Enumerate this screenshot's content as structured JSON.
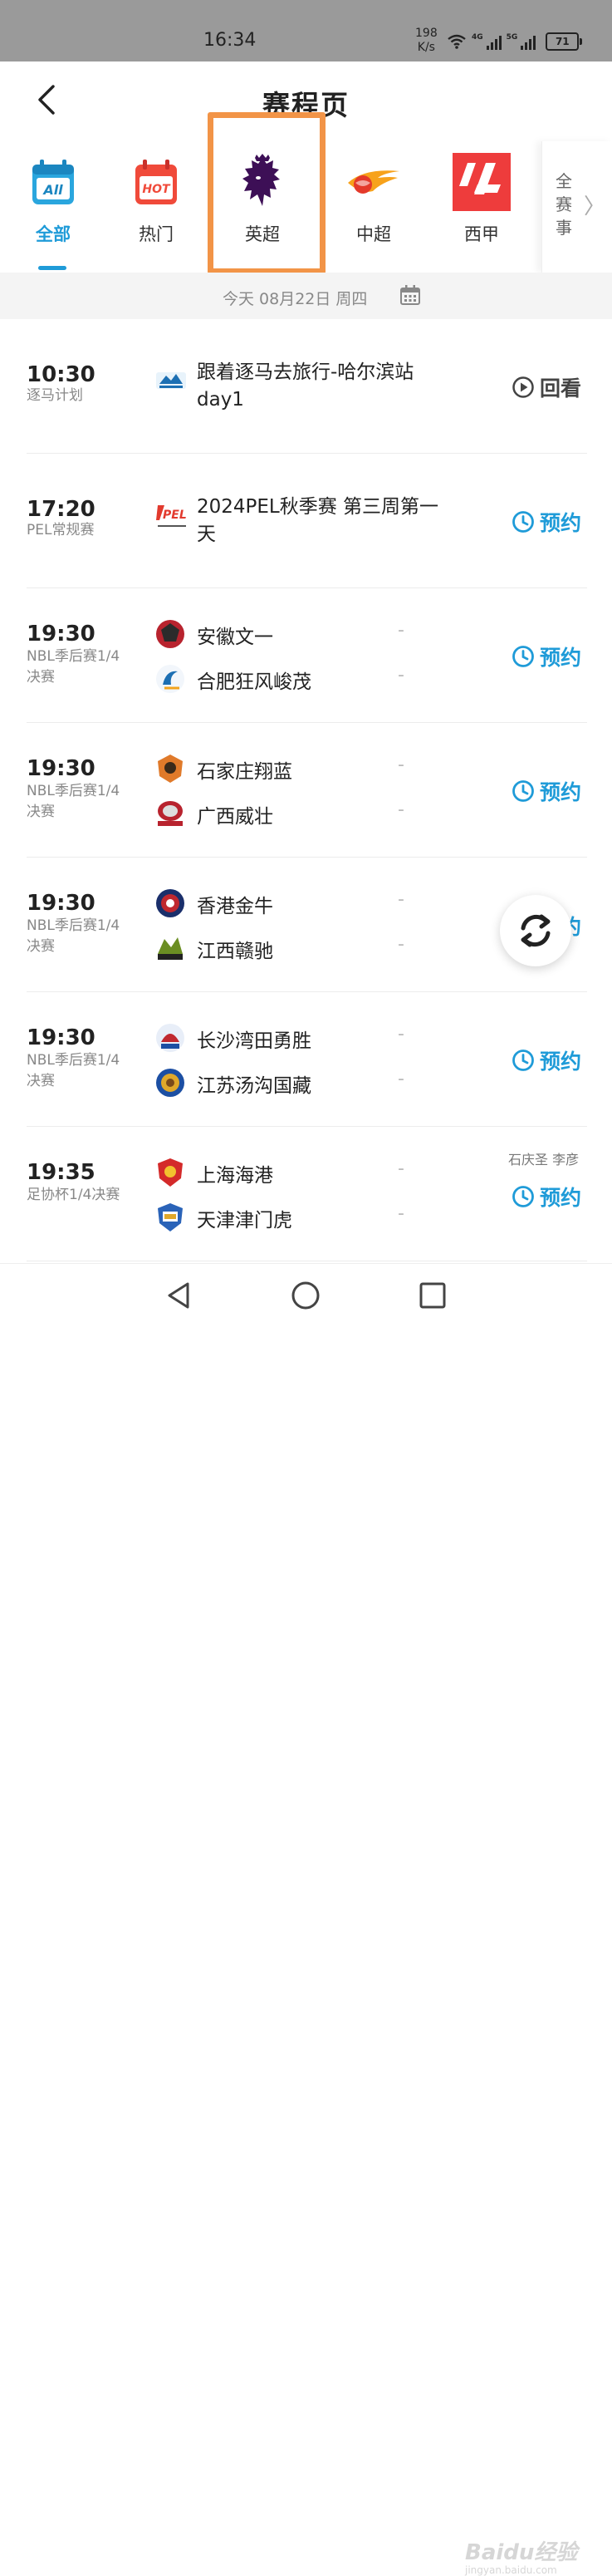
{
  "status_bar": {
    "time": "16:34",
    "net_speed_value": "198",
    "net_speed_unit": "K/s",
    "signal_1": "4G",
    "signal_2": "5G",
    "battery": "71"
  },
  "header": {
    "title": "赛程页"
  },
  "leagues": [
    {
      "label": "全部",
      "icon": "all-icon",
      "badge": "All",
      "active": true
    },
    {
      "label": "热门",
      "icon": "hot-icon",
      "badge": "HOT",
      "active": false
    },
    {
      "label": "英超",
      "icon": "premier-league-logo",
      "active": false
    },
    {
      "label": "中超",
      "icon": "csl-logo",
      "active": false
    },
    {
      "label": "西甲",
      "icon": "laliga-logo",
      "active": false
    }
  ],
  "all_events": {
    "label": "全赛事",
    "chevron": "〉"
  },
  "date_bar": {
    "text": "今天 08月22日 周四"
  },
  "matches": [
    {
      "time": "10:30",
      "subtitle": "逐马计划",
      "title": "跟着逐马去旅行-哈尔滨站day1",
      "action": "回看"
    },
    {
      "time": "17:20",
      "subtitle": "PEL常规赛",
      "title": "2024PEL秋季赛 第三周第一天",
      "logo_text": "PEL",
      "action": "预约"
    },
    {
      "time": "19:30",
      "subtitle": "NBL季后赛1/4决赛",
      "home": "安徽文一",
      "away": "合肥狂风峻茂",
      "home_score": "-",
      "away_score": "-",
      "action": "预约"
    },
    {
      "time": "19:30",
      "subtitle": "NBL季后赛1/4决赛",
      "home": "石家庄翔蓝",
      "away": "广西威壮",
      "home_score": "-",
      "away_score": "-",
      "action": "预约"
    },
    {
      "time": "19:30",
      "subtitle": "NBL季后赛1/4决赛",
      "home": "香港金牛",
      "away": "江西赣驰",
      "home_score": "-",
      "away_score": "-",
      "action": "预约"
    },
    {
      "time": "19:30",
      "subtitle": "NBL季后赛1/4决赛",
      "home": "长沙湾田勇胜",
      "away": "江苏汤沟国藏",
      "home_score": "-",
      "away_score": "-",
      "action": "预约"
    },
    {
      "time": "19:35",
      "subtitle": "足协杯1/4决赛",
      "home": "上海海港",
      "away": "天津津门虎",
      "home_score": "-",
      "away_score": "-",
      "referees": "石庆圣 李彦",
      "action": "预约"
    }
  ],
  "watermark": {
    "text": "Baidu经验",
    "sub": "jingyan.baidu.com"
  },
  "colors": {
    "accent": "#1f9bd8",
    "highlight": "#f29447",
    "status_bar": "#9a9a9a"
  }
}
